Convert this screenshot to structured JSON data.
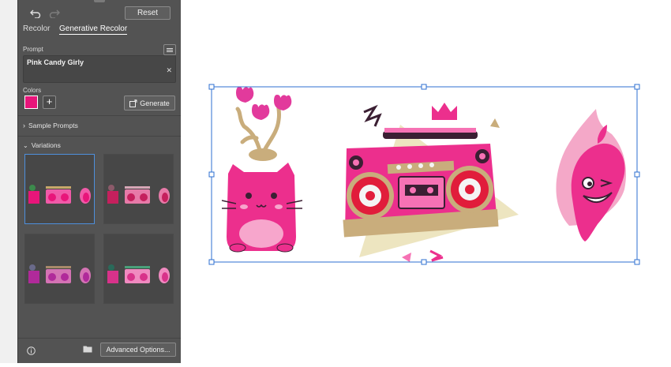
{
  "toolbar": {
    "reset_label": "Reset",
    "undo_icon": "undo-icon",
    "redo_icon": "redo-icon"
  },
  "tabs": [
    {
      "label": "Recolor",
      "active": false
    },
    {
      "label": "Generative Recolor",
      "active": true
    }
  ],
  "prompt": {
    "label": "Prompt",
    "value": "Pink Candy Girly",
    "menu_icon": "menu-icon",
    "clear_icon": "clear-icon"
  },
  "colors": {
    "label": "Colors",
    "swatch": "#e8157a",
    "add_icon": "plus-icon"
  },
  "generate": {
    "label": "Generate",
    "icon": "generate-icon"
  },
  "sections": {
    "sample_prompts": "Sample Prompts",
    "variations": "Variations"
  },
  "variations": [
    {
      "selected": true,
      "palette": [
        "#e8157a",
        "#f05aa8",
        "#c8a86a",
        "#3c8a4c"
      ]
    },
    {
      "selected": false,
      "palette": [
        "#c5205d",
        "#e77aa8",
        "#d6a6b6",
        "#8c5a6a"
      ]
    },
    {
      "selected": false,
      "palette": [
        "#b02a9a",
        "#d473b4",
        "#a88a6a",
        "#6a6a8a"
      ]
    },
    {
      "selected": false,
      "palette": [
        "#d8328a",
        "#f08ac0",
        "#4aa07a",
        "#2a6a5a"
      ]
    }
  ],
  "bottom": {
    "info_icon": "info-icon",
    "folder_icon": "folder-icon",
    "advanced_label": "Advanced Options..."
  },
  "artwork": {
    "pink": "#ec2f8d",
    "light_pink": "#f672b4",
    "tan": "#c9ad7c",
    "red": "#e11d3b",
    "dark": "#3b1f33"
  }
}
